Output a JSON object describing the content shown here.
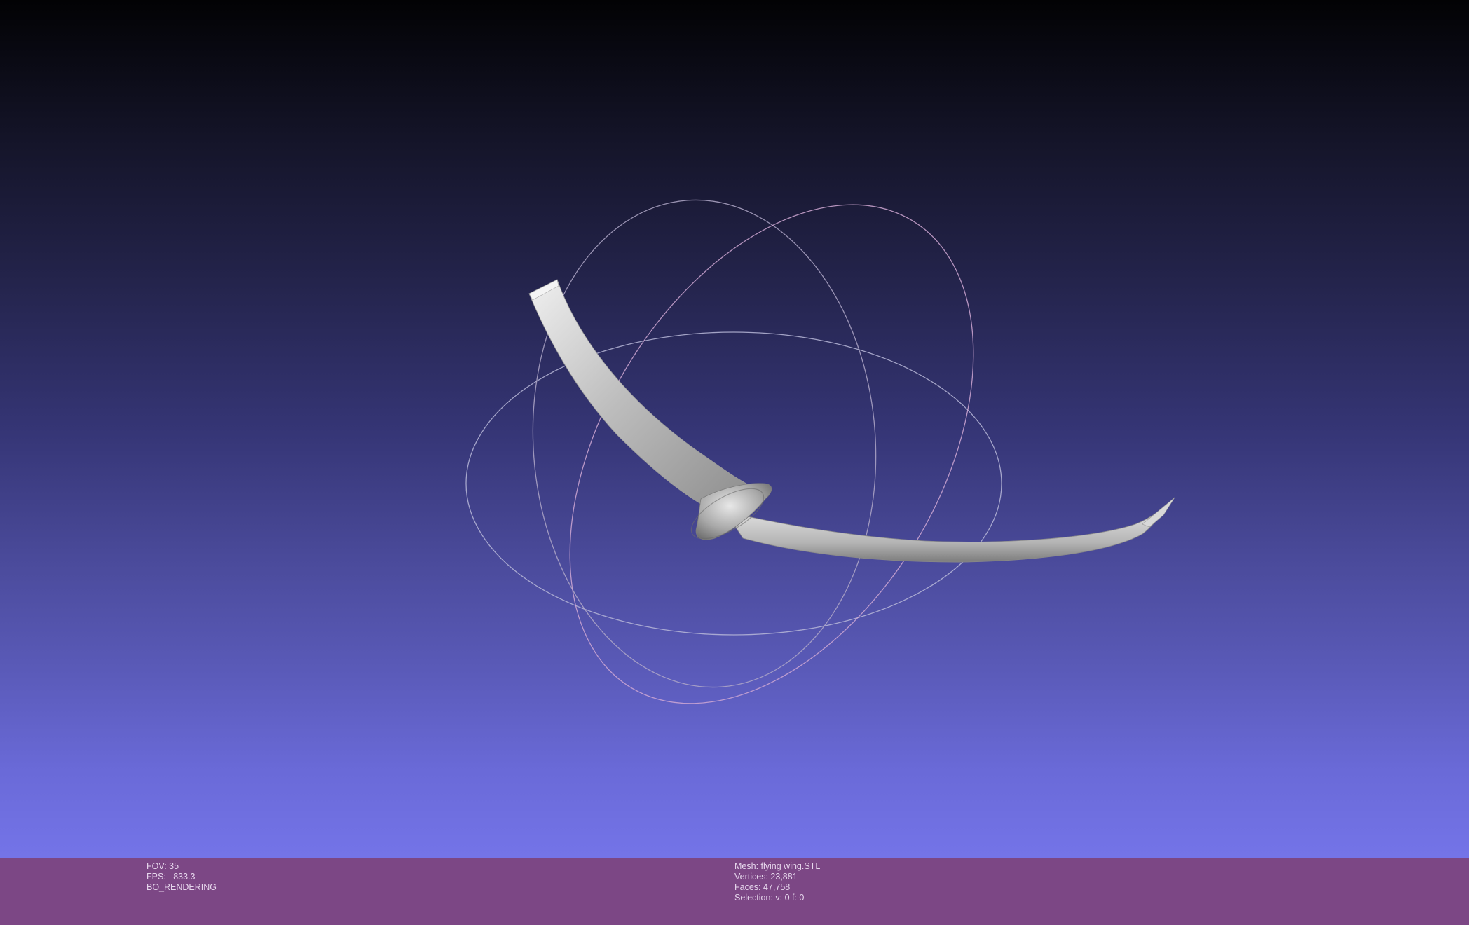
{
  "viewer": {
    "background_top": "#020204",
    "background_bottom": "#7474e8",
    "model_color": "#c8c8c8",
    "trackball": {
      "horizontal_ring_color": "#b8b8d8",
      "vertical_ring_color": "#c0a8c8",
      "tilted_ring_color": "#c8a8d0"
    }
  },
  "status_bar": {
    "background": "#7c4785",
    "left": {
      "fov": "FOV: 35",
      "fps": "FPS:   833.3",
      "render_mode": "BO_RENDERING"
    },
    "right": {
      "mesh": "Mesh: flying wing.STL",
      "vertices": "Vertices: 23,881",
      "faces": "Faces: 47,758",
      "selection": "Selection: v: 0 f: 0"
    }
  }
}
